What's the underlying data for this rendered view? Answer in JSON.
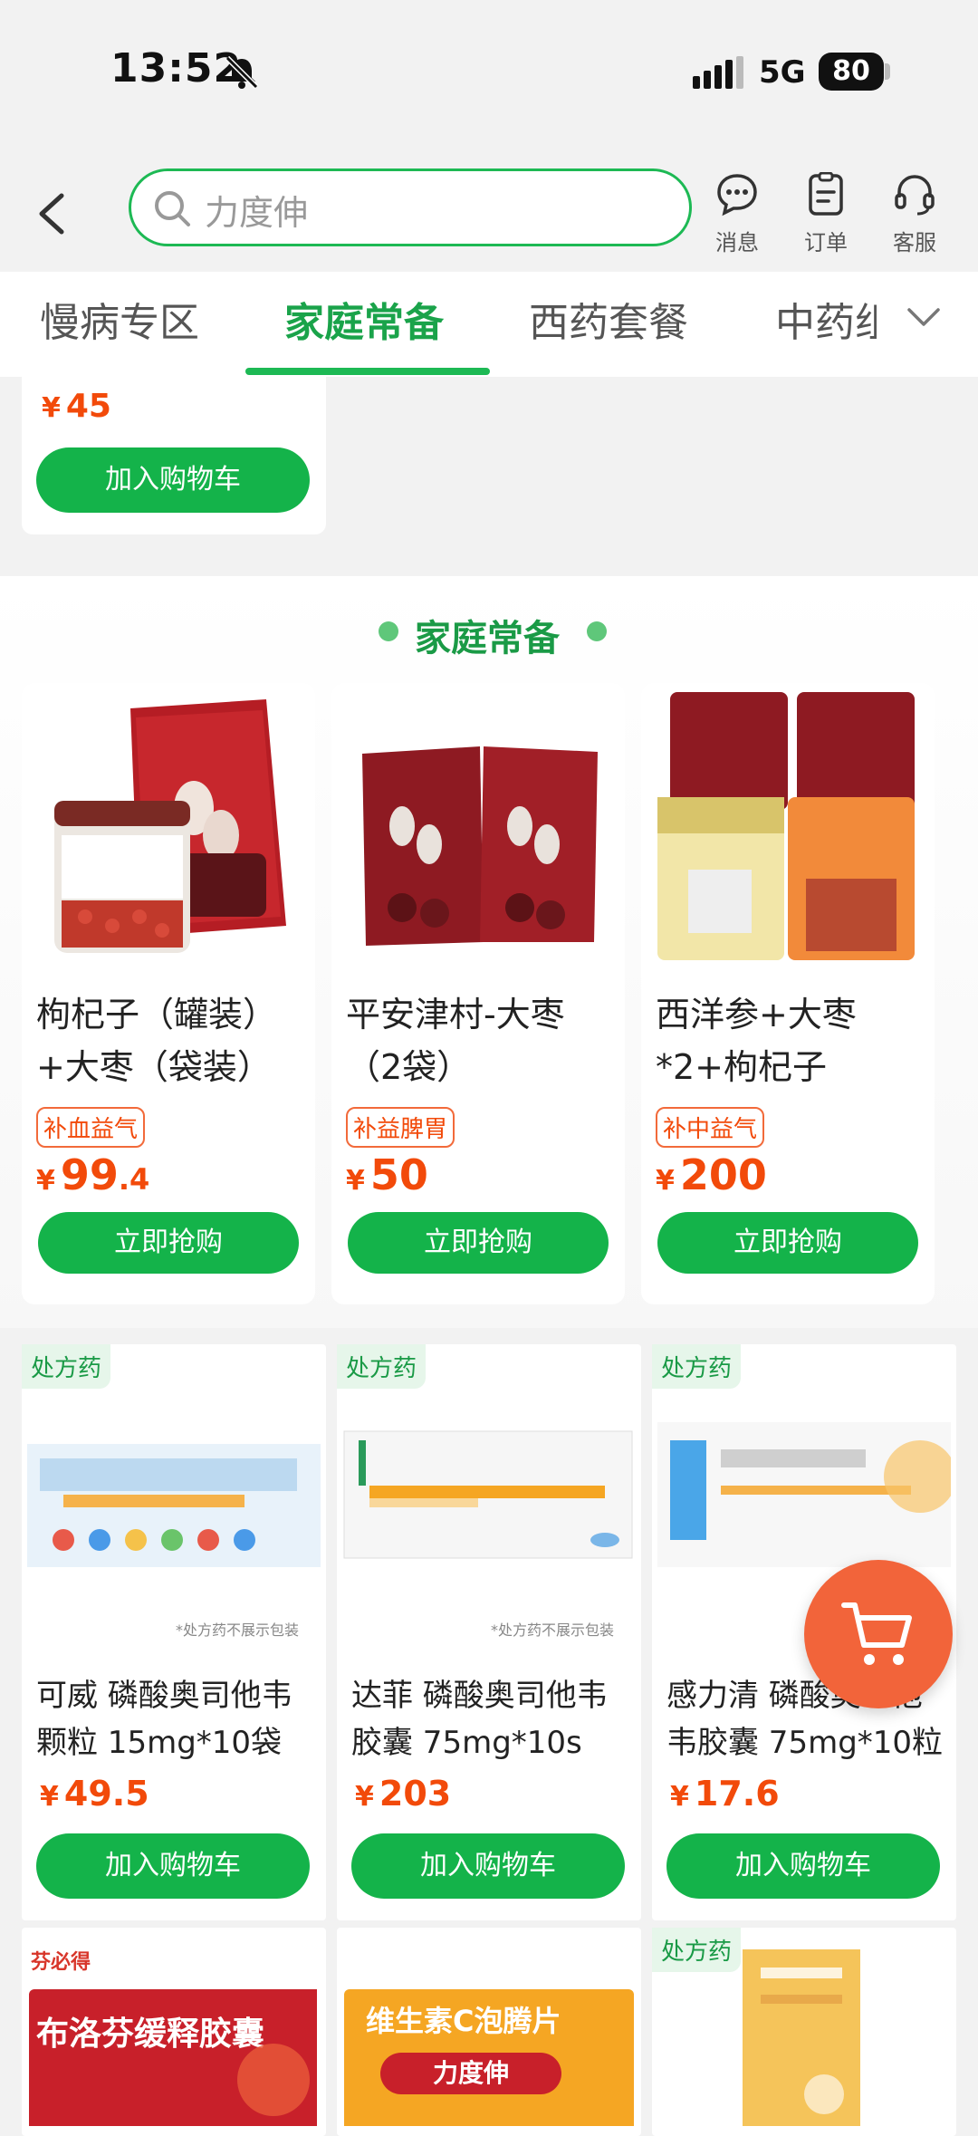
{
  "status": {
    "time": "13:52",
    "network": "5G",
    "battery": "80"
  },
  "header": {
    "search_placeholder": "力度伸",
    "messages": "消息",
    "orders": "订单",
    "service": "客服"
  },
  "tabs": [
    "慢病专区",
    "家庭常备",
    "西药套餐",
    "中药组"
  ],
  "prev_card": {
    "price": "45",
    "cart_label": "加入购物车"
  },
  "section_title": "家庭常备",
  "featured": [
    {
      "title_line1": "枸杞子（罐装）",
      "title_line2": "+大枣（袋装）",
      "tag": "补血益气",
      "price_int": "99",
      "price_dec": ".4",
      "button": "立即抢购"
    },
    {
      "title_line1": "平安津村-大枣",
      "title_line2": "（2袋）",
      "tag": "补益脾胃",
      "price_int": "50",
      "price_dec": "",
      "button": "立即抢购"
    },
    {
      "title_line1": "西洋参+大枣",
      "title_line2": "*2+枸杞子",
      "tag": "补中益气",
      "price_int": "200",
      "price_dec": "",
      "button": "立即抢购"
    }
  ],
  "products": [
    {
      "badge": "处方药",
      "name_line1": "可威 磷酸奥司他韦",
      "name_line2": "颗粒 15mg*10袋",
      "price": "49.5",
      "note": "*处方药不展示包装",
      "button": "加入购物车"
    },
    {
      "badge": "处方药",
      "name_line1": "达菲 磷酸奥司他韦",
      "name_line2": "胶囊 75mg*10s",
      "price": "203",
      "note": "*处方药不展示包装",
      "button": "加入购物车"
    },
    {
      "badge": "处方药",
      "name_line1": "感力清 磷酸奥司他",
      "name_line2": "韦胶囊 75mg*10粒",
      "price": "17.6",
      "note": "",
      "button": "加入购物车"
    }
  ],
  "bottom_row": {
    "p1_text": "布洛芬缓释胶囊",
    "p1_brand": "芬必得",
    "p2_text": "维生素C泡腾片",
    "p2_brand": "力度伸",
    "p3_badge": "处方药"
  },
  "symbols": {
    "yen": "¥"
  },
  "colors": {
    "accent": "#14b34a",
    "price": "#f24a0a",
    "cart_fab": "#f2643a"
  }
}
